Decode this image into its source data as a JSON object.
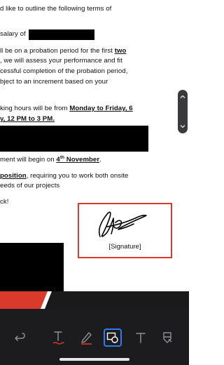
{
  "document": {
    "lines": [
      "d like to outline the following terms of",
      "salary of",
      "ll be on a probation period for the first",
      "two",
      ", we will assess your performance and fit",
      "cessful completion of the probation period,",
      "bject to an increment based on your",
      "king hours will be from",
      "Monday to Friday, 6",
      "y, 12 PM to 3 PM.",
      "ment will begin on",
      "4",
      "th",
      "November",
      ".",
      "position",
      ", requiring you to work both onsite",
      "eeds of our projects",
      "ck!"
    ],
    "signature_caption": "[Signature]"
  },
  "colors": {
    "accent_red": "#d93a2b",
    "footer_dark": "#1a1a1a",
    "toolbar_bg": "#1c1c1e",
    "active_tool": "#2f7bf6"
  },
  "toolbar": {
    "tools": [
      {
        "icon": "undo-icon"
      },
      {
        "icon": "text-underline-icon"
      },
      {
        "icon": "highlighter-icon"
      },
      {
        "icon": "shapes-icon",
        "active": true
      },
      {
        "icon": "text-icon"
      },
      {
        "icon": "eraser-icon"
      }
    ]
  }
}
